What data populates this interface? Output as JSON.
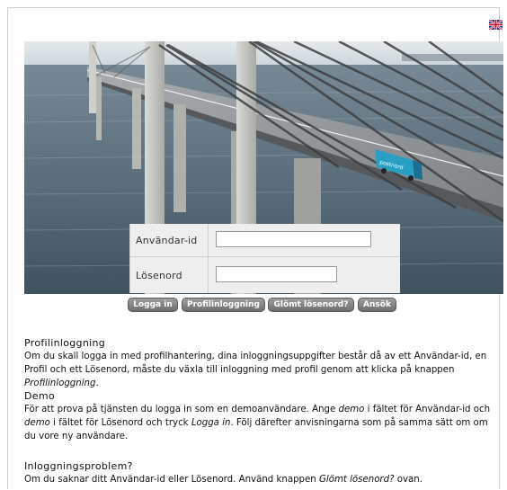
{
  "language_flag": {
    "icon": "uk-flag-icon",
    "alt": "English"
  },
  "hero": {
    "icon": "bridge-photo",
    "truck_text": "postnord"
  },
  "login": {
    "username_label": "Användar-id",
    "username_value": "",
    "password_label": "Lösenord",
    "password_value": ""
  },
  "buttons": {
    "login": "Logga in",
    "profile_login": "Profilinloggning",
    "forgot_password": "Glömt lösenord?",
    "apply": "Ansök"
  },
  "sections": [
    {
      "title": "Profilinloggning",
      "body_pre": "Om du skall logga in med profilhantering, dina inloggningsuppgifter består då av ett Användar-id, en Profil och ett Lösenord, måste du växla till inloggning med profil genom att klicka på knappen ",
      "body_em": "Profilinloggning",
      "body_post": "."
    },
    {
      "title": "Demo",
      "body_1": "För att prova på tjänsten du logga in som en demoanvändare. Ange ",
      "em_1": "demo",
      "body_2": " i fältet för Användar-id och ",
      "em_2": "demo",
      "body_3": " i fältet för Lösenord och tryck ",
      "em_3": "Logga in",
      "body_4": ". Följ därefter anvisningarna som på samma sätt om om du vore ny användare."
    },
    {
      "title": "Inloggningsproblem?",
      "body_pre": "Om du saknar ditt Användar-id eller Lösenord. Använd knappen ",
      "body_em": "Glömt lösenord?",
      "body_post": " ovan."
    }
  ],
  "colors": {
    "button": "#7f7f7f",
    "panel": "#eeeeee",
    "truck": "#2a9fc4"
  }
}
